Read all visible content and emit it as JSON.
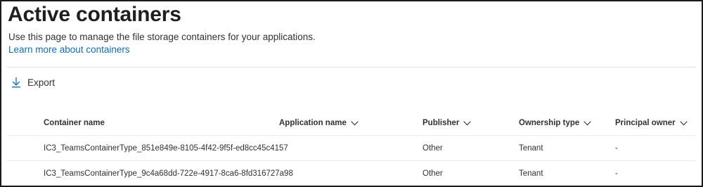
{
  "page": {
    "title": "Active containers",
    "description": "Use this page to manage the file storage containers for your applications.",
    "learn_more": "Learn more about containers"
  },
  "toolbar": {
    "export_label": "Export",
    "export_icon": "download-icon"
  },
  "table": {
    "columns": [
      {
        "label": "Container name",
        "sortable": false
      },
      {
        "label": "Application name",
        "sortable": true
      },
      {
        "label": "Publisher",
        "sortable": true
      },
      {
        "label": "Ownership type",
        "sortable": true
      },
      {
        "label": "Principal owner",
        "sortable": true
      }
    ],
    "rows": [
      {
        "container_name": "IC3_TeamsContainerType_851e849e-8105-4f42-9f5f-ed8cc45c4157",
        "application_name": "",
        "publisher": "Other",
        "ownership_type": "Tenant",
        "principal_owner": "-"
      },
      {
        "container_name": "IC3_TeamsContainerType_9c4a68dd-722e-4917-8ca6-8fd316727a98",
        "application_name": "",
        "publisher": "Other",
        "ownership_type": "Tenant",
        "principal_owner": "-"
      }
    ]
  },
  "colors": {
    "link": "#0f6cbd",
    "text": "#201f1e",
    "divider": "#e1dfdd"
  }
}
